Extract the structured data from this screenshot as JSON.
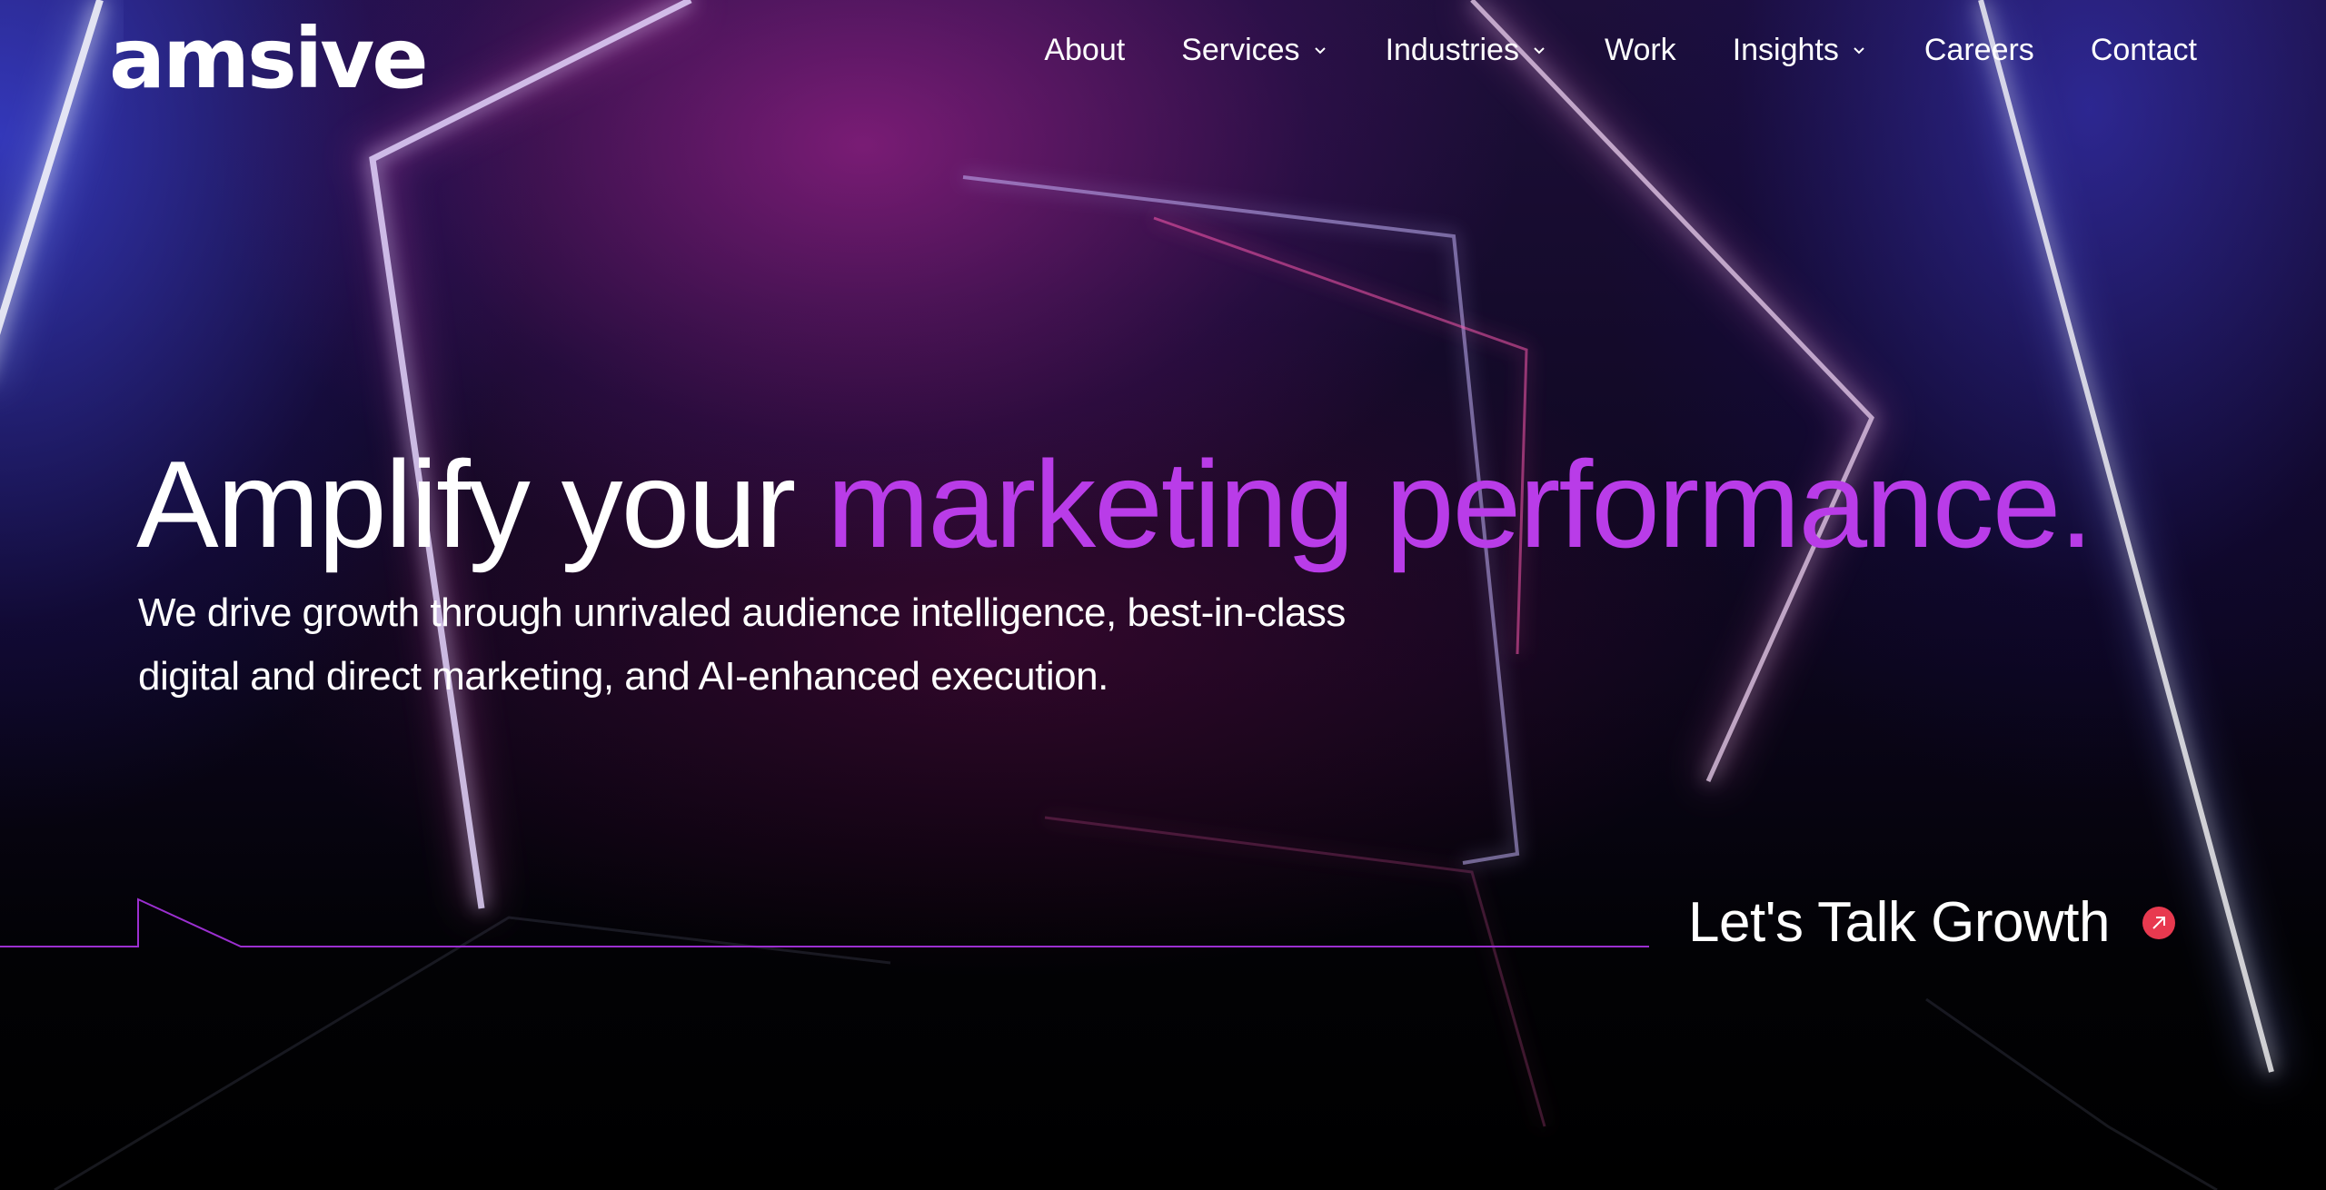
{
  "brand": {
    "logo_text": "amsive",
    "accent_color": "#b93ce8",
    "cta_icon_color": "#e8394f"
  },
  "nav": {
    "items": [
      {
        "label": "About",
        "has_dropdown": false
      },
      {
        "label": "Services",
        "has_dropdown": true
      },
      {
        "label": "Industries",
        "has_dropdown": true
      },
      {
        "label": "Work",
        "has_dropdown": false
      },
      {
        "label": "Insights",
        "has_dropdown": true
      },
      {
        "label": "Careers",
        "has_dropdown": false
      },
      {
        "label": "Contact",
        "has_dropdown": false
      }
    ]
  },
  "hero": {
    "headline_plain": "Amplify your ",
    "headline_accent": "marketing performance.",
    "subtext": "We drive growth through unrivaled audience intelligence, best-in-class digital and direct marketing, and AI-enhanced execution.",
    "cta_label": "Let's Talk Growth",
    "cta_icon": "arrow-up-right-icon"
  }
}
